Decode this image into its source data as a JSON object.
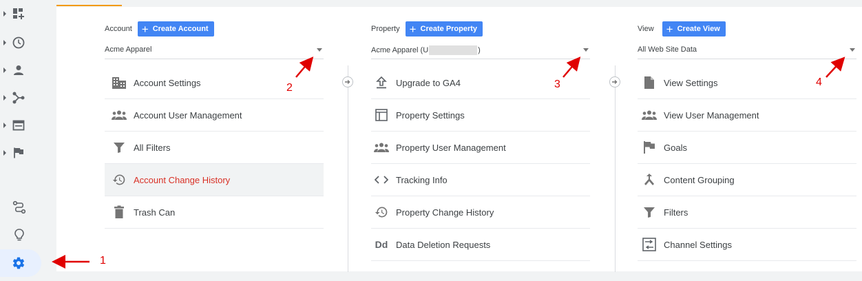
{
  "rail": {
    "items": [
      {
        "name": "customization",
        "icon": "dashboard-plus-icon"
      },
      {
        "name": "realtime",
        "icon": "clock-icon"
      },
      {
        "name": "audience",
        "icon": "person-icon"
      },
      {
        "name": "acquisition",
        "icon": "branch-icon"
      },
      {
        "name": "behavior",
        "icon": "browser-window-icon"
      },
      {
        "name": "conversions",
        "icon": "flag-icon"
      }
    ],
    "bottom": [
      {
        "name": "attribution",
        "icon": "route-icon"
      },
      {
        "name": "discover",
        "icon": "lightbulb-icon"
      },
      {
        "name": "admin",
        "icon": "gear-icon"
      }
    ]
  },
  "account": {
    "label": "Account",
    "create_label": "Create Account",
    "selected": "Acme Apparel",
    "items": [
      {
        "label": "Account Settings",
        "icon": "building-icon"
      },
      {
        "label": "Account User Management",
        "icon": "people-icon"
      },
      {
        "label": "All Filters",
        "icon": "filter-icon"
      },
      {
        "label": "Account Change History",
        "icon": "history-icon",
        "active": true
      },
      {
        "label": "Trash Can",
        "icon": "trash-icon"
      }
    ]
  },
  "property": {
    "label": "Property",
    "create_label": "Create Property",
    "selected_prefix": "Acme Apparel (U",
    "selected_suffix": ")",
    "items": [
      {
        "label": "Upgrade to GA4",
        "icon": "upload-icon"
      },
      {
        "label": "Property Settings",
        "icon": "layout-icon"
      },
      {
        "label": "Property User Management",
        "icon": "people-icon"
      },
      {
        "label": "Tracking Info",
        "icon": "code-icon"
      },
      {
        "label": "Property Change History",
        "icon": "history-icon"
      },
      {
        "label": "Data Deletion Requests",
        "icon": "dd-text-icon",
        "icon_text": "Dd"
      }
    ]
  },
  "view": {
    "label": "View",
    "create_label": "Create View",
    "selected": "All Web Site Data",
    "items": [
      {
        "label": "View Settings",
        "icon": "document-icon"
      },
      {
        "label": "View User Management",
        "icon": "people-icon"
      },
      {
        "label": "Goals",
        "icon": "flag-icon"
      },
      {
        "label": "Content Grouping",
        "icon": "merge-icon"
      },
      {
        "label": "Filters",
        "icon": "filter-icon"
      },
      {
        "label": "Channel Settings",
        "icon": "channel-settings-icon"
      }
    ]
  },
  "annotations": {
    "n1": "1",
    "n2": "2",
    "n3": "3",
    "n4": "4",
    "color": "#e00000"
  },
  "colors": {
    "accent": "#4285f4",
    "active_text": "#d93025",
    "tab_underline": "#f29900"
  }
}
